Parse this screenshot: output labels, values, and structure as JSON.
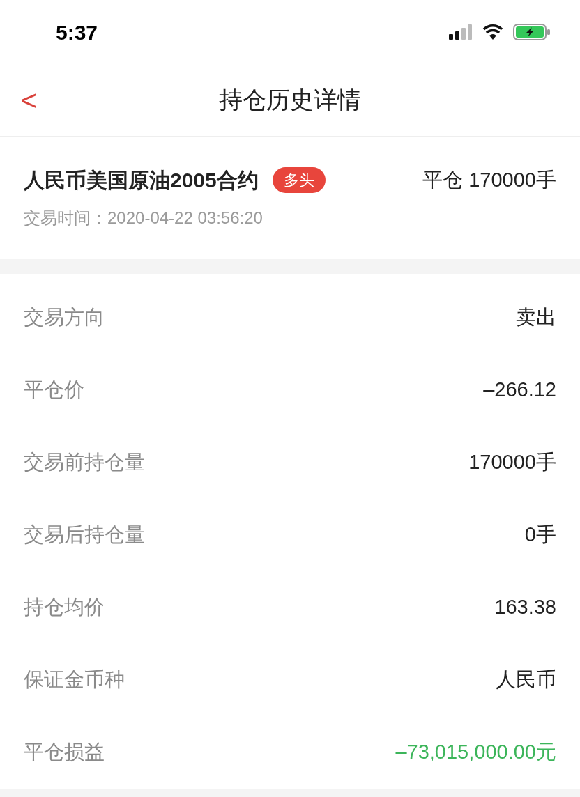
{
  "status_bar": {
    "time": "5:37"
  },
  "nav": {
    "back": "<",
    "title": "持仓历史详情"
  },
  "header": {
    "name": "人民币美国原油2005合约",
    "tag": "多头",
    "action": "平仓 170000手",
    "time_label": "交易时间：",
    "time": "2020-04-22 03:56:20"
  },
  "rows": [
    {
      "label": "交易方向",
      "value": "卖出",
      "color": "#222222"
    },
    {
      "label": "平仓价",
      "value": "–266.12",
      "color": "#222222"
    },
    {
      "label": "交易前持仓量",
      "value": "170000手",
      "color": "#222222"
    },
    {
      "label": "交易后持仓量",
      "value": "0手",
      "color": "#222222"
    },
    {
      "label": "持仓均价",
      "value": "163.38",
      "color": "#222222"
    },
    {
      "label": "保证金币种",
      "value": "人民币",
      "color": "#222222"
    },
    {
      "label": "平仓损益",
      "value": "–73,015,000.00元",
      "color": "#3cb55a"
    }
  ]
}
